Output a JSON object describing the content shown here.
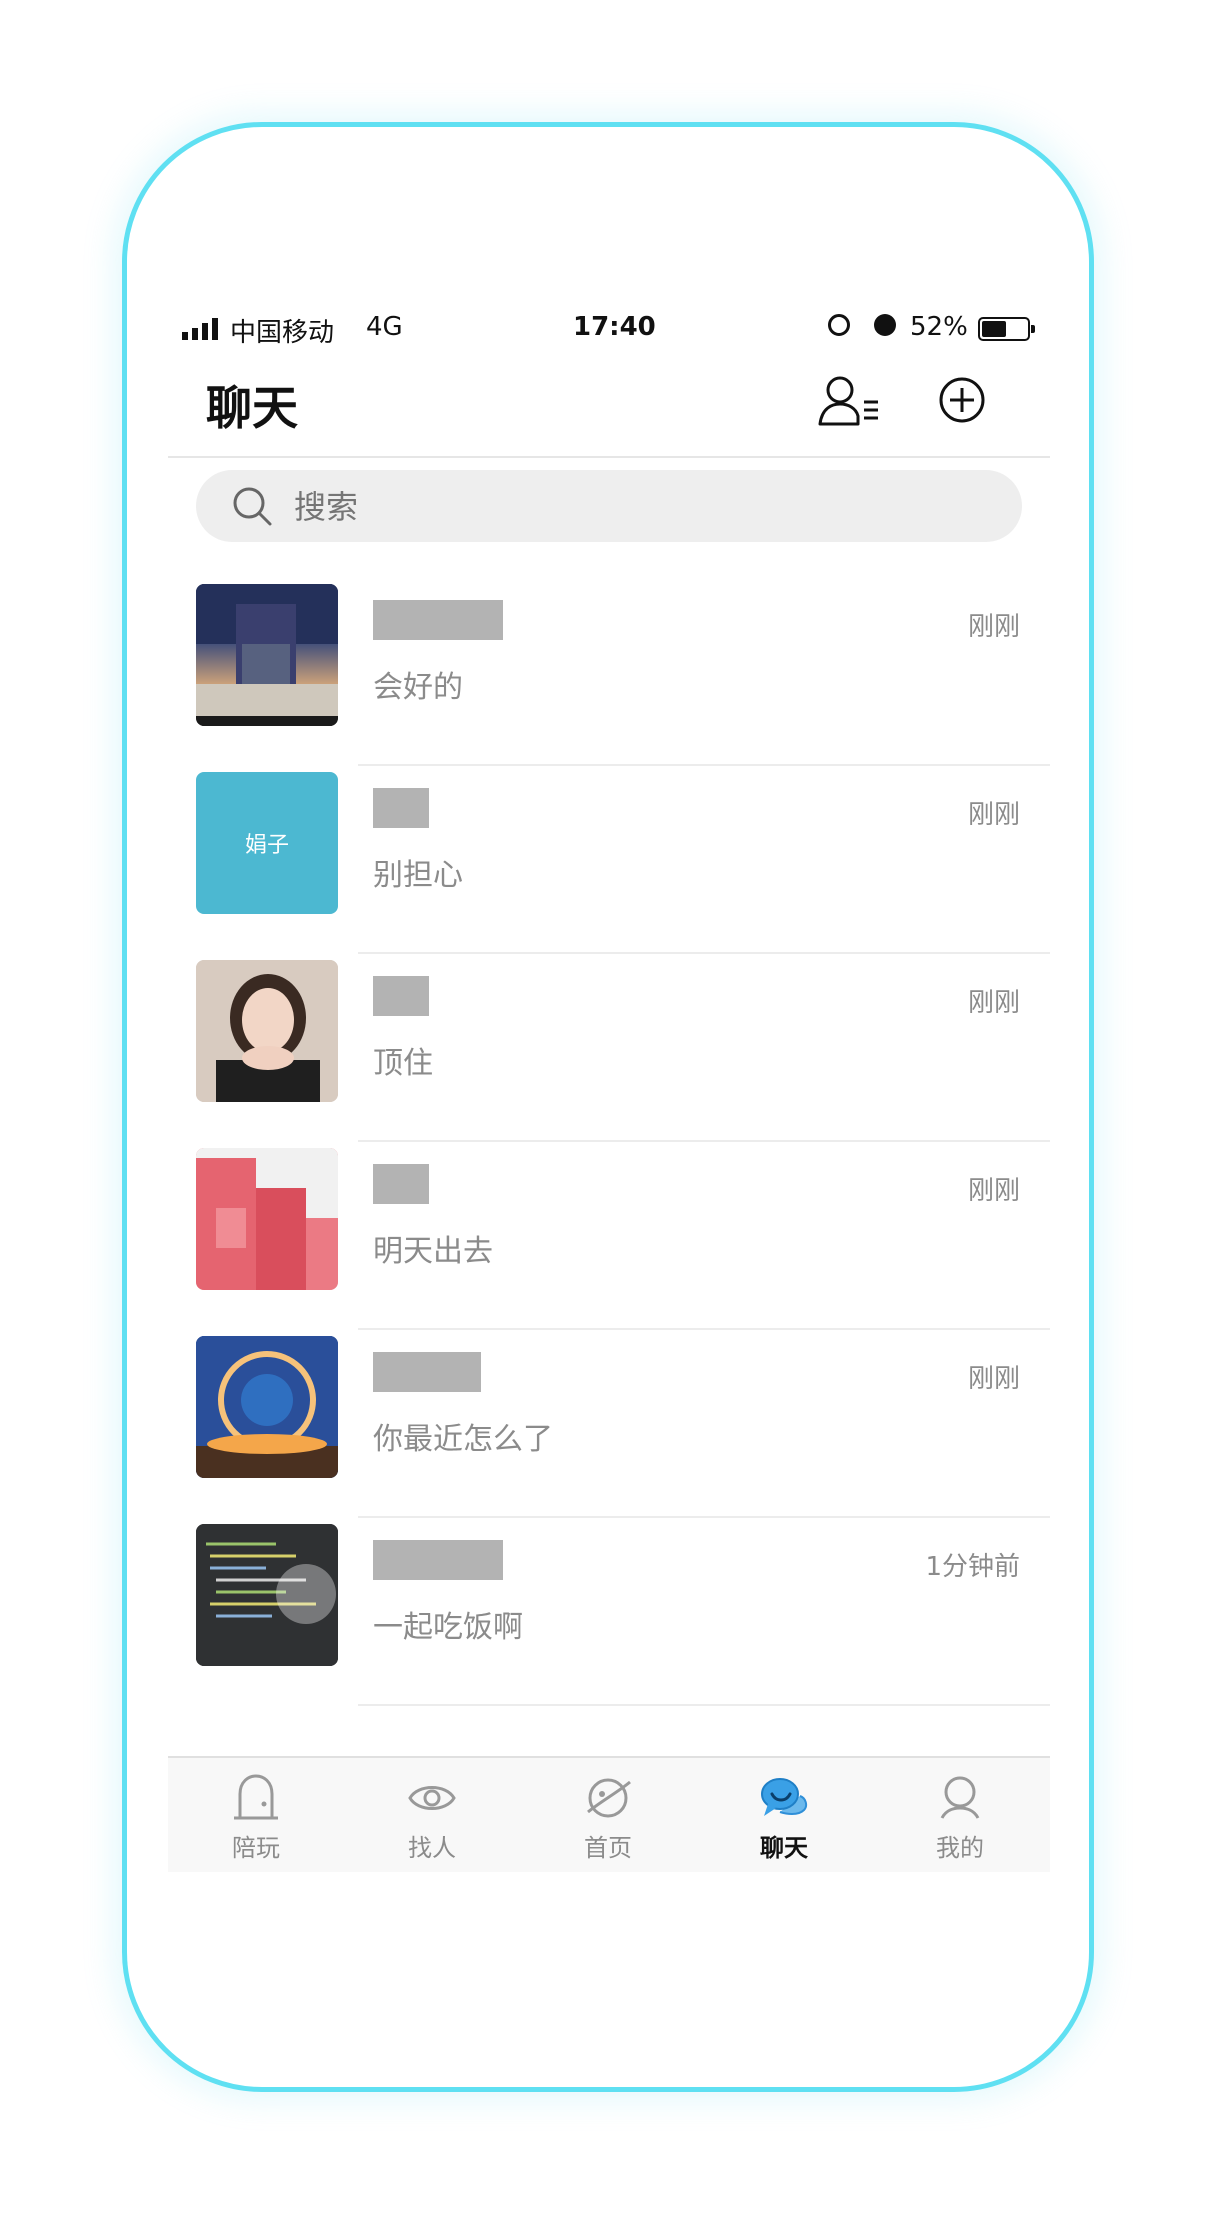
{
  "status_bar": {
    "carrier": "中国移动",
    "network": "4G",
    "time": "17:40",
    "battery": "52%"
  },
  "header": {
    "title": "聊天",
    "contacts_icon": "contacts-list-icon",
    "add_icon": "plus-circle-icon"
  },
  "search": {
    "placeholder": "搜索",
    "icon": "search-icon"
  },
  "chats": [
    {
      "name": "",
      "avatar_text": "",
      "message": "会好的",
      "time": "刚刚"
    },
    {
      "name": "",
      "avatar_text": "娟子",
      "message": "别担心",
      "time": "刚刚"
    },
    {
      "name": "",
      "avatar_text": "",
      "message": "顶住",
      "time": "刚刚"
    },
    {
      "name": "",
      "avatar_text": "",
      "message": "明天出去",
      "time": "刚刚"
    },
    {
      "name": "",
      "avatar_text": "",
      "message": "你最近怎么了",
      "time": "刚刚"
    },
    {
      "name": "",
      "avatar_text": "",
      "message": "一起吃饭啊",
      "time": "1分钟前"
    }
  ],
  "tabs": [
    {
      "label": "陪玩",
      "icon": "door-icon",
      "active": false
    },
    {
      "label": "找人",
      "icon": "eye-icon",
      "active": false
    },
    {
      "label": "首页",
      "icon": "planet-icon",
      "active": false
    },
    {
      "label": "聊天",
      "icon": "chat-bubble-icon",
      "active": true
    },
    {
      "label": "我的",
      "icon": "person-icon",
      "active": false
    }
  ],
  "colors": {
    "frame": "#5fe0f2",
    "avatar_accent": "#4cb8d1",
    "active_tab": "#3aa0e6"
  }
}
